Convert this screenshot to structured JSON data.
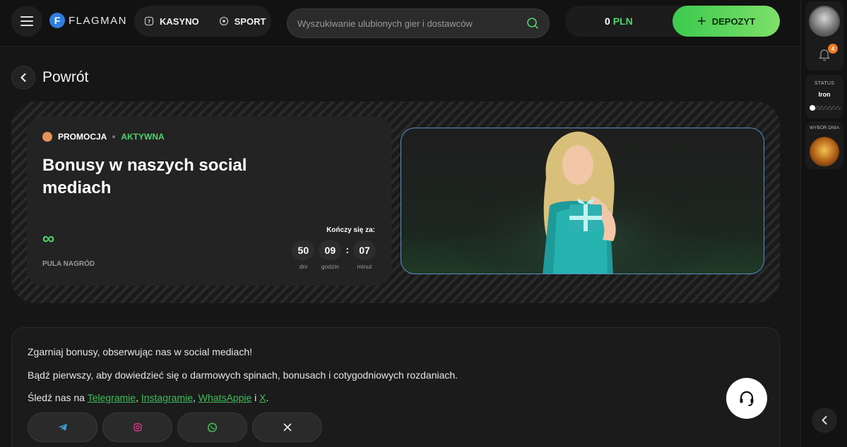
{
  "header": {
    "logo_text": "FLAGMAN",
    "logo_letter": "F",
    "nav": [
      {
        "label": "KASYNO",
        "icon": "slot-icon"
      },
      {
        "label": "SPORT",
        "icon": "ball-icon"
      }
    ],
    "search_placeholder": "Wyszukiwanie ulubionych gier i dostawców",
    "balance_amount": "0",
    "balance_currency": "PLN",
    "deposit_label": "DEPOZYT"
  },
  "back_label": "Powrót",
  "promo": {
    "tag": "PROMOCJA",
    "status": "AKTYWNA",
    "title": "Bonusy w naszych social mediach",
    "pool_value": "∞",
    "pool_label": "PULA NAGRÓD",
    "ends_label": "Kończy się za:",
    "timer": [
      {
        "value": "50",
        "label": "dni"
      },
      {
        "value": "09",
        "label": "godzin"
      },
      {
        "value": "07",
        "label": "minut"
      }
    ]
  },
  "description": {
    "line1": "Zgarniaj bonusy, obserwując nas w social mediach!",
    "line2": "Bądź pierwszy, aby dowiedzieć się o darmowych spinach, bonusach i cotygodniowych rozdaniach.",
    "line3_prefix": "Śledź nas na ",
    "links": [
      "Telegramie",
      "Instagramie",
      "WhatsAppie",
      "X"
    ],
    "sep_comma": ", ",
    "sep_and": " i ",
    "line3_suffix": ".",
    "socials": [
      "telegram-icon",
      "instagram-icon",
      "whatsapp-icon",
      "x-icon"
    ]
  },
  "rail": {
    "notifications_count": "4",
    "status_label": "STATUS",
    "status_value": "Iron",
    "daily_label": "WYBÓR DNIA"
  },
  "colors": {
    "accent": "#4fd36c",
    "link": "#3fbd5b",
    "notification": "#f07a25"
  }
}
